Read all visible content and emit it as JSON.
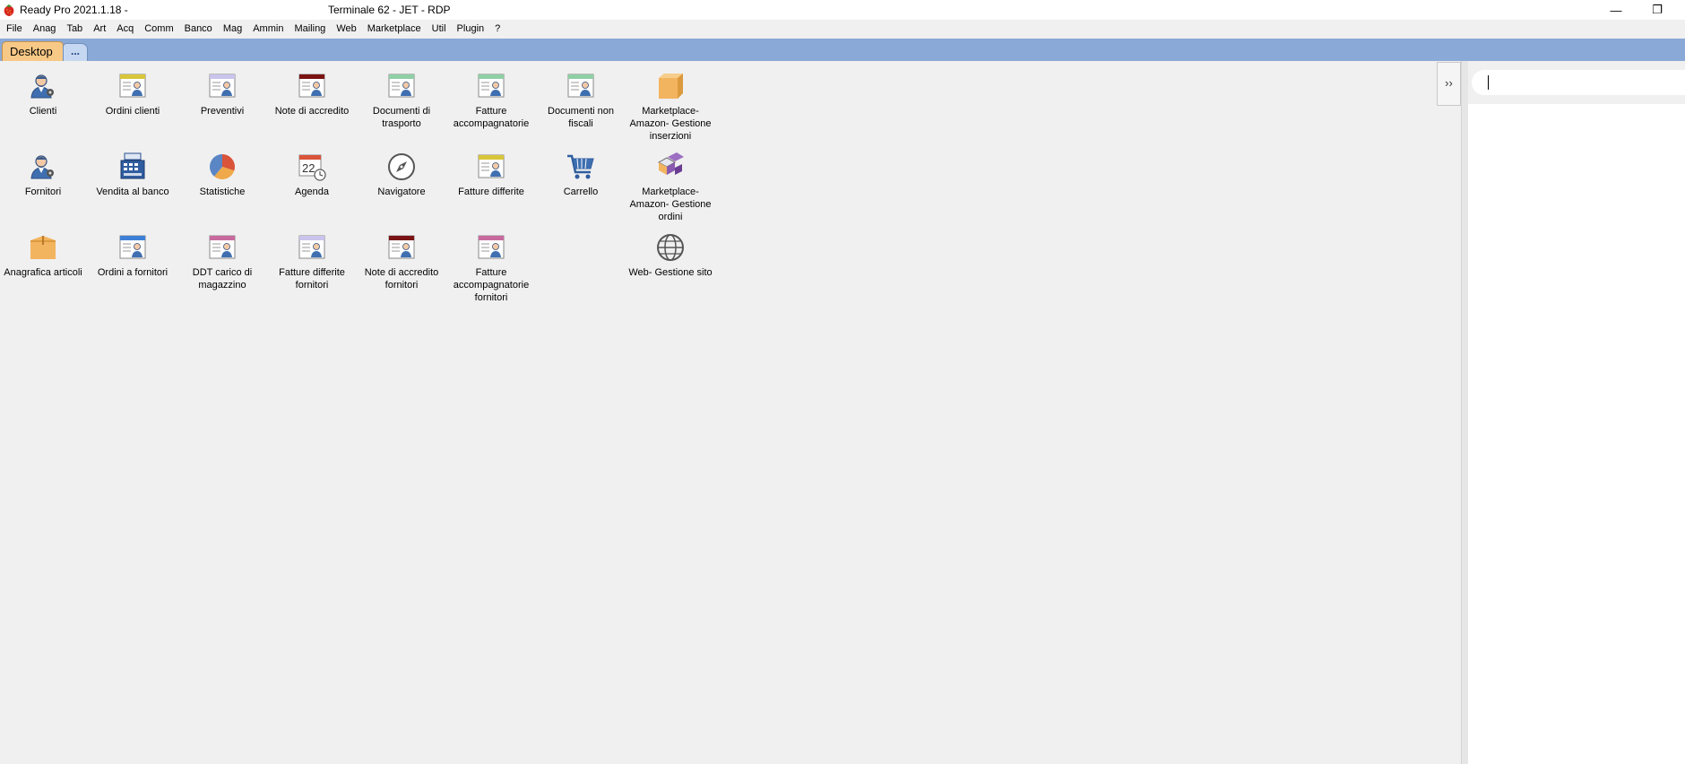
{
  "titlebar": {
    "app_title": "Ready Pro 2021.1.18 -",
    "window_title": "Terminale 62 - JET - RDP",
    "minimize_glyph": "—",
    "restore_glyph": "❐",
    "app_icon": "strawberry-icon"
  },
  "menu": [
    "File",
    "Anag",
    "Tab",
    "Art",
    "Acq",
    "Comm",
    "Banco",
    "Mag",
    "Ammin",
    "Mailing",
    "Web",
    "Marketplace",
    "Util",
    "Plugin",
    "?"
  ],
  "tabs": {
    "desktop": "Desktop",
    "more": "..."
  },
  "desktop_icons": [
    {
      "label": "Clienti",
      "icon": "customer-icon"
    },
    {
      "label": "Ordini clienti",
      "icon": "customer-orders-icon"
    },
    {
      "label": "Preventivi",
      "icon": "quotes-icon"
    },
    {
      "label": "Note di accredito",
      "icon": "credit-notes-icon"
    },
    {
      "label": "Documenti di trasporto",
      "icon": "transport-documents-icon"
    },
    {
      "label": "Fatture accompagnatorie",
      "icon": "accompanying-invoices-icon"
    },
    {
      "label": "Documenti non fiscali",
      "icon": "non-fiscal-documents-icon"
    },
    {
      "label": "Marketplace- Amazon- Gestione inserzioni",
      "icon": "marketplace-listings-icon"
    },
    {
      "label": "Fornitori",
      "icon": "suppliers-icon"
    },
    {
      "label": "Vendita al banco",
      "icon": "cash-register-icon"
    },
    {
      "label": "Statistiche",
      "icon": "pie-chart-icon"
    },
    {
      "label": "Agenda",
      "icon": "calendar-icon"
    },
    {
      "label": "Navigatore",
      "icon": "compass-icon"
    },
    {
      "label": "Fatture differite",
      "icon": "deferred-invoices-icon"
    },
    {
      "label": "Carrello",
      "icon": "shopping-cart-icon"
    },
    {
      "label": "Marketplace- Amazon- Gestione ordini",
      "icon": "marketplace-orders-icon"
    },
    {
      "label": "Anagrafica articoli",
      "icon": "product-box-icon"
    },
    {
      "label": "Ordini a fornitori",
      "icon": "supplier-orders-icon"
    },
    {
      "label": "DDT carico di magazzino",
      "icon": "warehouse-load-icon"
    },
    {
      "label": "Fatture differite fornitori",
      "icon": "supplier-deferred-invoices-icon"
    },
    {
      "label": "Note di accredito fornitori",
      "icon": "supplier-credit-notes-icon"
    },
    {
      "label": "Fatture accompagnatorie fornitori",
      "icon": "supplier-accompanying-invoices-icon"
    },
    {
      "label": "Web- Gestione sito",
      "icon": "globe-icon"
    }
  ],
  "side_panel": {
    "toggle_label": "››",
    "search_value": ""
  },
  "colors": {
    "tab_strip": "#8aa9d6",
    "active_tab": "#f8c986",
    "desktop_bg": "#f0f0f0"
  }
}
